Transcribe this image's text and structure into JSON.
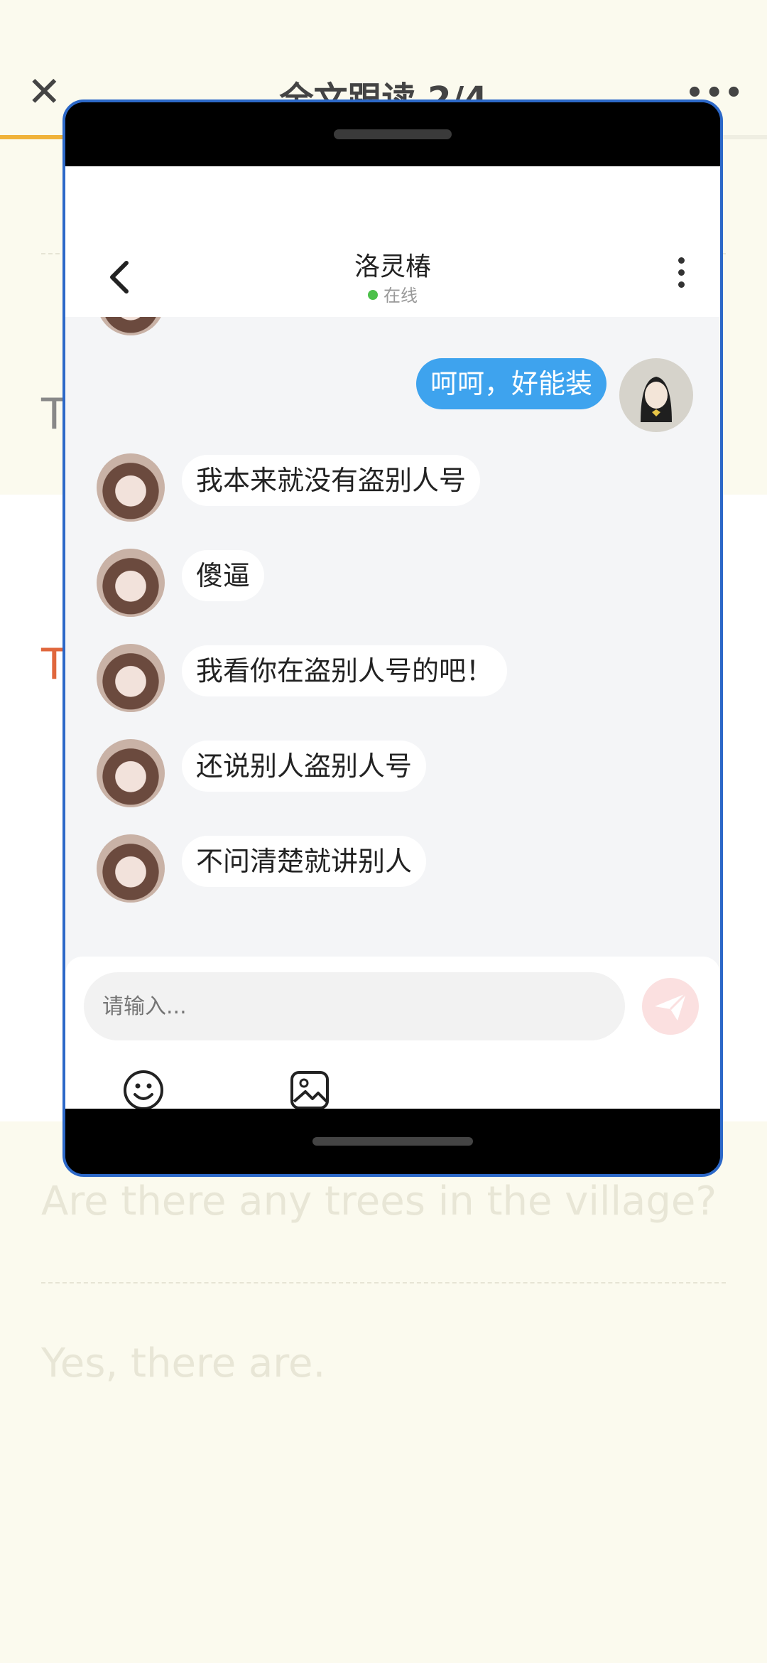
{
  "background": {
    "title": "全文跟读 2/4",
    "close_icon": "close-icon",
    "more_icon": "more-icon",
    "letter_1": "T",
    "letter_2": "T",
    "question_text": "Are there any trees in the village?",
    "answer_text": "Yes, there are."
  },
  "chat": {
    "contact_name": "洛灵椿",
    "status": "在线",
    "status_color": "#4cc04a",
    "messages": [
      {
        "from": "me",
        "text": "呵呵，好能装"
      },
      {
        "from": "her",
        "text": "我本来就没有盗别人号"
      },
      {
        "from": "her",
        "text": "傻逼"
      },
      {
        "from": "her",
        "text": "我看你在盗别人号的吧！"
      },
      {
        "from": "her",
        "text": "还说别人盗别人号"
      },
      {
        "from": "her",
        "text": "不问清楚就讲别人"
      }
    ],
    "input_placeholder": "请输入...",
    "accent_color": "#3ea3ee"
  },
  "icons": {
    "back": "back-icon",
    "menu": "more-vertical-icon",
    "send": "send-icon",
    "emoji": "emoji-icon",
    "image": "image-icon"
  }
}
